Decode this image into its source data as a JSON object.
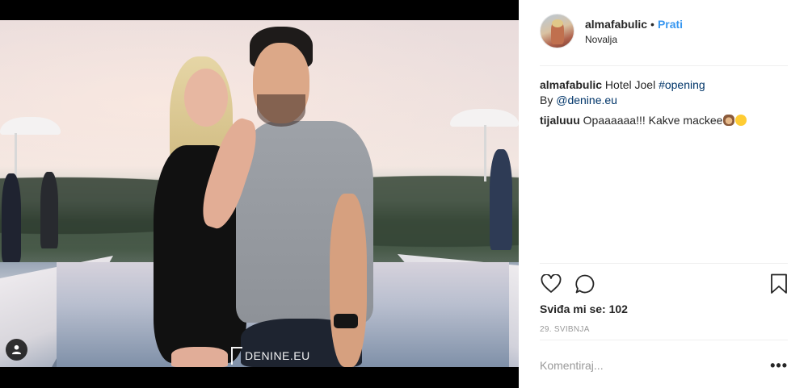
{
  "post": {
    "username": "almafabulic",
    "separator": "•",
    "follow_label": "Prati",
    "location": "Novalja",
    "watermark": "DENINE.EU",
    "caption": {
      "author": "almafabulic",
      "text": "Hotel Joel",
      "hashtag": "#opening",
      "by_prefix": "By",
      "mention": "@denine.eu"
    },
    "comments": [
      {
        "author": "tijaluuu",
        "text": "Opaaaaaa!!! Kakve mackee",
        "emojis": [
          "see-no-evil-monkey",
          "heart-eyes"
        ]
      }
    ],
    "likes_text": "Sviđa mi se: 102",
    "date_text": "29. svibnja",
    "comment_placeholder": "Komentiraj...",
    "more_label": "•••"
  },
  "colors": {
    "link_blue": "#3897f0",
    "mention_blue": "#003569",
    "text": "#262626",
    "muted": "#999999"
  },
  "icons": {
    "like": "heart-outline-icon",
    "comment": "speech-bubble-icon",
    "save": "bookmark-icon",
    "user_tag": "user-icon"
  }
}
